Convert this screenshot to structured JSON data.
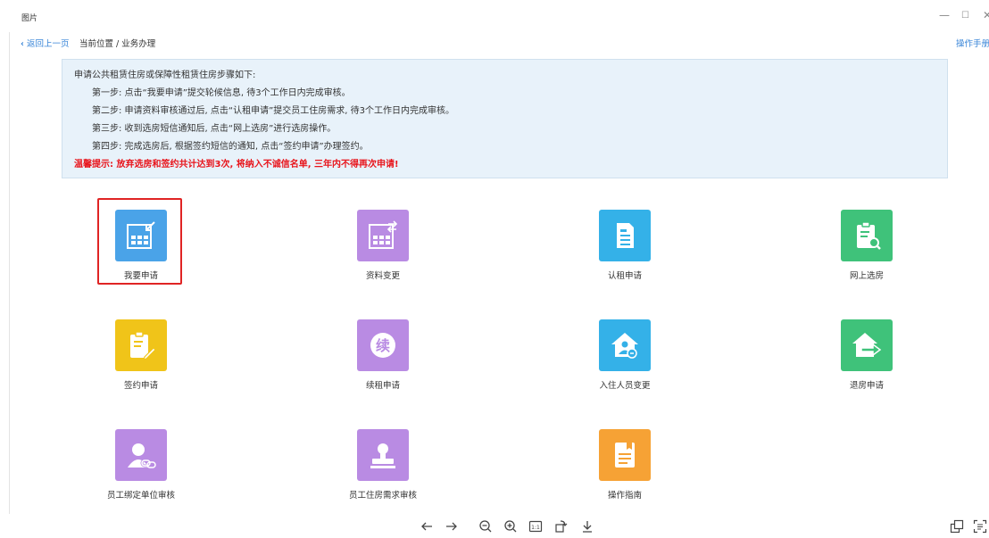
{
  "window": {
    "title": "图片",
    "minimize": "—",
    "maximize": "☐",
    "close": "✕"
  },
  "nav": {
    "back": "返回上一页",
    "breadcrumb": "当前位置 / 业务办理",
    "manual": "操作手册"
  },
  "notice": {
    "intro": "申请公共租赁住房或保障性租赁住房步骤如下:",
    "steps": [
      "第一步: 点击“我要申请”提交轮候信息, 待3个工作日内完成审核。",
      "第二步: 申请资料审核通过后, 点击“认租申请”提交员工住房需求, 待3个工作日内完成审核。",
      "第三步: 收到选房短信通知后, 点击“网上选房”进行选房操作。",
      "第四步: 完成选房后, 根据签约短信的通知, 点击“签约申请”办理签约。"
    ],
    "warning": "温馨提示: 放弃选房和签约共计达到3次, 将纳入不诚信名单, 三年内不得再次申请!"
  },
  "tiles": [
    {
      "label": "我要申请",
      "icon": "table-import-icon",
      "color": "#4aa3e8"
    },
    {
      "label": "资料变更",
      "icon": "table-swap-icon",
      "color": "#b98be3"
    },
    {
      "label": "认租申请",
      "icon": "document-icon",
      "color": "#34b1e8"
    },
    {
      "label": "网上选房",
      "icon": "clipboard-search-icon",
      "color": "#3fc27a"
    },
    {
      "label": "签约申请",
      "icon": "clipboard-edit-icon",
      "color": "#f0c419"
    },
    {
      "label": "续租申请",
      "icon": "renew-icon",
      "color": "#b98be3"
    },
    {
      "label": "入住人员变更",
      "icon": "house-person-icon",
      "color": "#34b1e8"
    },
    {
      "label": "退房申请",
      "icon": "house-exit-icon",
      "color": "#3fc27a"
    },
    {
      "label": "员工绑定单位审核",
      "icon": "user-link-icon",
      "color": "#b98be3"
    },
    {
      "label": "员工住房需求审核",
      "icon": "user-stamp-icon",
      "color": "#b98be3"
    },
    {
      "label": "操作指南",
      "icon": "guide-book-icon",
      "color": "#f6a235"
    }
  ],
  "renew_glyph": "续",
  "viewer_tools": [
    "previous-arrow-icon",
    "next-arrow-icon",
    "zoom-out-icon",
    "zoom-in-icon",
    "actual-size-icon",
    "rotate-icon",
    "download-icon",
    "gallery-icon",
    "ocr-icon"
  ],
  "actual_size_label": "1:1"
}
